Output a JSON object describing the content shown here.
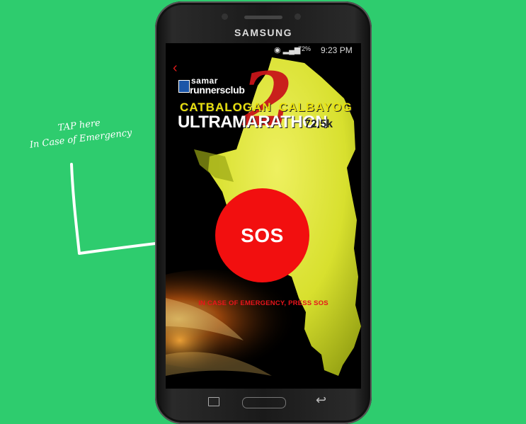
{
  "annotation": {
    "line1": "TAP here",
    "line2": "In Case of Emergency"
  },
  "phone": {
    "brand": "SAMSUNG",
    "status": {
      "battery": "72%",
      "time": "9:23 PM"
    },
    "app": {
      "club_line1": "samar",
      "club_line2": "runnersclub",
      "city_from": "CATBALOGAN",
      "city_to": "CALBAYOG",
      "big_number": "2",
      "event": "ULTRAMARATHON",
      "distance": "72.5k",
      "sos_label": "SOS",
      "instruction": "IN CASE OF EMERGENCY, PRESS SOS"
    }
  },
  "colors": {
    "background": "#2ecc6e",
    "sos": "#f20f0f",
    "map_yellow": "#e1e63c",
    "accent_red": "#c8161a"
  }
}
